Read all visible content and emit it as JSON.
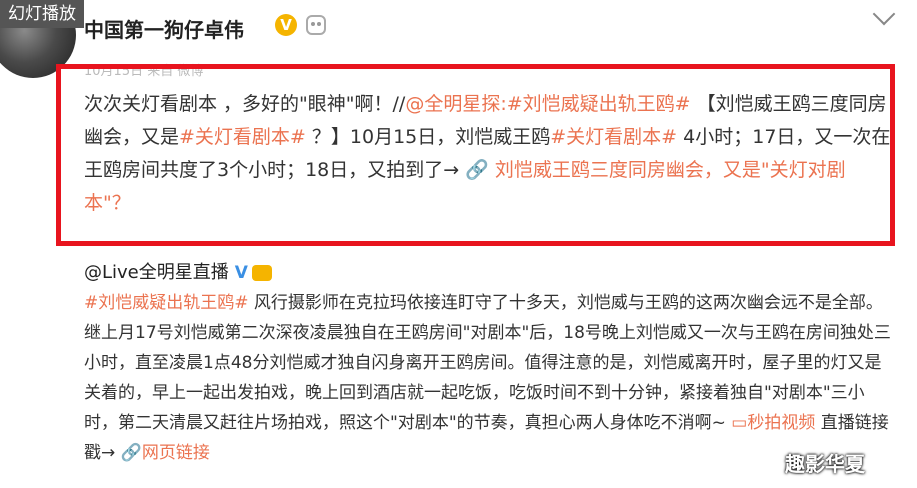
{
  "overlay_tag": "幻灯播放",
  "post": {
    "author": "中国第一狗仔卓伟",
    "vip_badge": "V",
    "meta_text": "10月15日 来自 微博",
    "text": {
      "p1": "次次关灯看剧本 ，多好的\"眼神\"啊！//",
      "p2": "@全明星探",
      "p3": ":",
      "p4": "#刘恺威疑出轨王鸥#",
      "p5": "【刘恺威王鸥三度同房幽会，又是",
      "p6": "#关灯看剧本#",
      "p7": "？】10月15日，刘恺威王鸥",
      "p8": "#关灯看剧本#",
      "p9": "4小时；17日，又一次在王鸥房间共度了3个小时；18日，又拍到了→",
      "p10": "🔗 刘恺威王鸥三度同房幽会，又是\"关灯对剧本\"？"
    }
  },
  "repost": {
    "author": "@Live全明星直播",
    "verified": "V",
    "text": {
      "r1": "#刘恺威疑出轨王鸥#",
      "r2": "风行摄影师在克拉玛依接连盯守了十多天，刘恺威与王鸥的这两次幽会远不是全部。继上月17号刘恺威第二次深夜凌晨独自在王鸥房间\"对剧本\"后，18号晚上刘恺威又一次与王鸥在房间独处三小时，直至凌晨1点48分刘恺威才独自闪身离开王鸥房间。值得注意的是，刘恺威离开时，屋子里的灯又是关着的，早上一起出发拍戏，晚上回到酒店就一起吃饭，吃饭时间不到十分钟，紧接着独自\"对剧本\"三小时，第二天清晨又赶往片场拍戏，照这个\"对剧本\"的节奏，真担心两人身体吃不消啊~",
      "r3": "▭秒拍视频",
      "r4": "直播链接戳→",
      "r5": "🔗网页链接"
    }
  },
  "watermark": "趣影华夏",
  "colors": {
    "link": "#eb7350",
    "highlight_border": "#e8141e",
    "vip": "#f5b400"
  },
  "icons": [
    "chevron-down-icon",
    "robot-icon",
    "link-icon",
    "video-icon"
  ]
}
